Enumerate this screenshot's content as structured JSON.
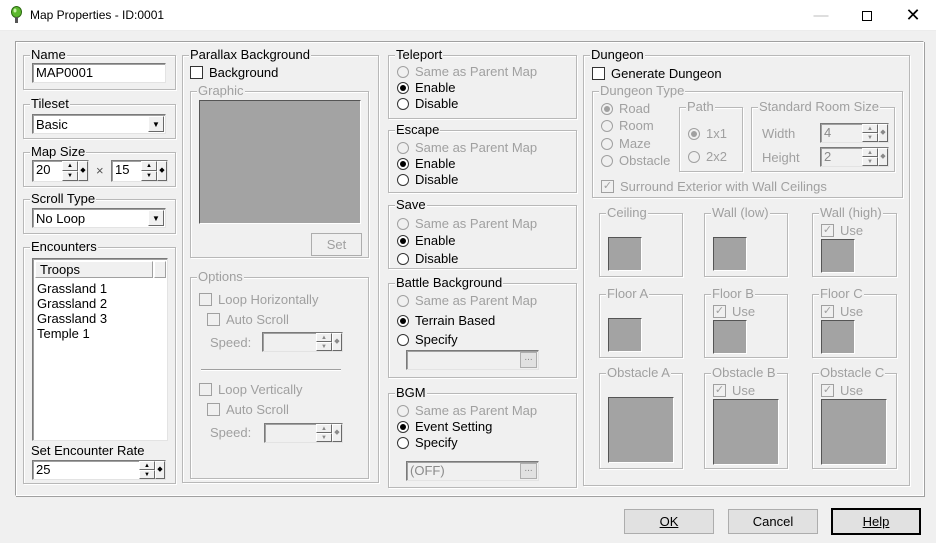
{
  "window": {
    "title": "Map Properties - ID:0001",
    "minimize_icon": "minimize-icon",
    "maximize_icon": "maximize-icon",
    "close_icon": "close-icon"
  },
  "name": {
    "label": "Name",
    "value": "MAP0001"
  },
  "tileset": {
    "label": "Tileset",
    "value": "Basic"
  },
  "map_size": {
    "label": "Map Size",
    "width": "20",
    "height": "15",
    "separator": "×"
  },
  "scroll_type": {
    "label": "Scroll Type",
    "value": "No Loop"
  },
  "encounters": {
    "label": "Encounters",
    "column_header": "Troops",
    "troops": [
      "Grassland 1",
      "Grassland 2",
      "Grassland 3",
      "Temple 1"
    ],
    "rate_label": "Set Encounter Rate",
    "rate_value": "25"
  },
  "parallax": {
    "label": "Parallax Background",
    "background_checkbox": "Background",
    "graphic_label": "Graphic",
    "set_button": "Set",
    "options_label": "Options",
    "loop_horizontally": "Loop Horizontally",
    "auto_scroll_h": "Auto Scroll",
    "speed_h": "Speed:",
    "loop_vertically": "Loop Vertically",
    "auto_scroll_v": "Auto Scroll",
    "speed_v": "Speed:"
  },
  "teleport": {
    "label": "Teleport",
    "options": [
      "Same as Parent Map",
      "Enable",
      "Disable"
    ],
    "selected": 1
  },
  "escape": {
    "label": "Escape",
    "options": [
      "Same as Parent Map",
      "Enable",
      "Disable"
    ],
    "selected": 1
  },
  "save": {
    "label": "Save",
    "options": [
      "Same as Parent Map",
      "Enable",
      "Disable"
    ],
    "selected": 1
  },
  "battle_background": {
    "label": "Battle Background",
    "options": [
      "Same as Parent Map",
      "Terrain Based",
      "Specify"
    ],
    "selected": 1,
    "browse": "..."
  },
  "bgm": {
    "label": "BGM",
    "options": [
      "Same as Parent Map",
      "Event Setting",
      "Specify"
    ],
    "selected": 1,
    "value": "(OFF)",
    "browse": "..."
  },
  "dungeon": {
    "label": "Dungeon",
    "generate": "Generate Dungeon",
    "type_label": "Dungeon Type",
    "types": [
      "Road",
      "Room",
      "Maze",
      "Obstacle"
    ],
    "path_label": "Path",
    "paths": [
      "1x1",
      "2x2"
    ],
    "room_size_label": "Standard Room Size",
    "width_label": "Width",
    "width_value": "4",
    "height_label": "Height",
    "height_value": "2",
    "surround": "Surround Exterior with Wall Ceilings",
    "tiles": {
      "ceiling": "Ceiling",
      "wall_low": "Wall (low)",
      "wall_high": "Wall (high)",
      "floor_a": "Floor A",
      "floor_b": "Floor B",
      "floor_c": "Floor C",
      "obstacle_a": "Obstacle A",
      "obstacle_b": "Obstacle B",
      "obstacle_c": "Obstacle C",
      "use": "Use"
    }
  },
  "buttons": {
    "ok": "OK",
    "cancel": "Cancel",
    "help": "Help"
  }
}
